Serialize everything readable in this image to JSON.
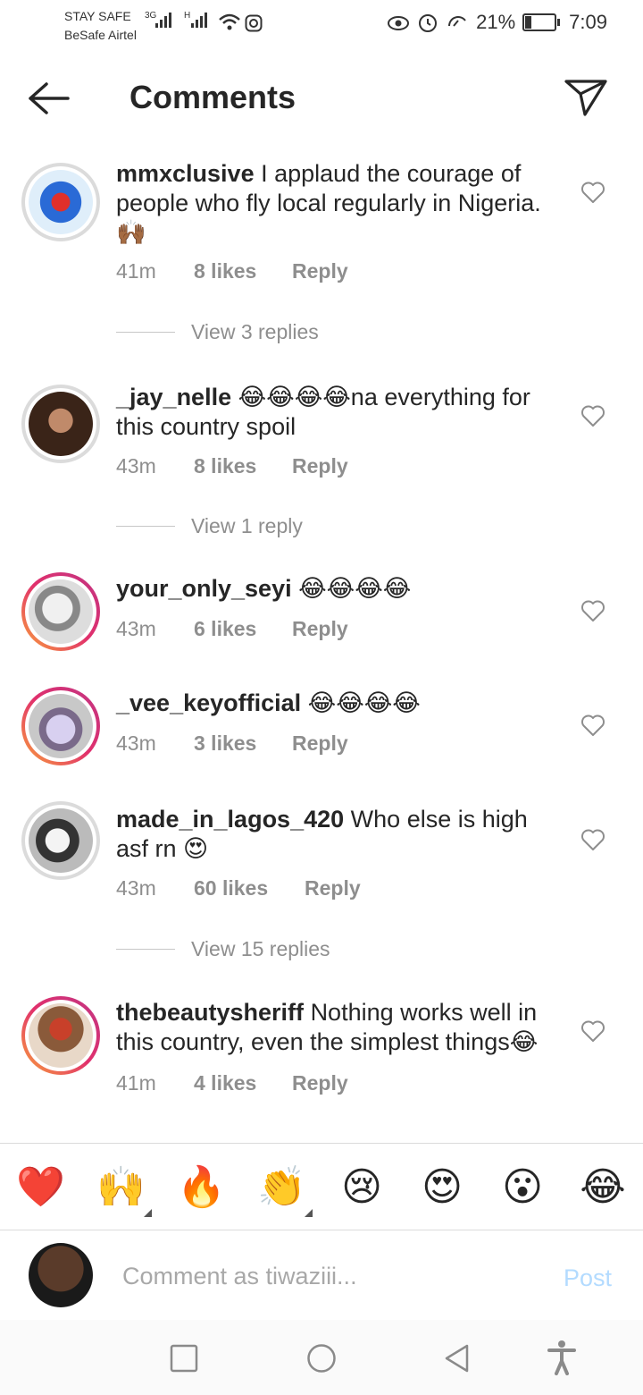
{
  "status_bar": {
    "carrier_line1": "STAY SAFE",
    "carrier_line2": "BeSafe Airtel",
    "net1": "3G",
    "net2": "H",
    "battery_percent": "21%",
    "battery_level": 0.21,
    "time": "7:09"
  },
  "header": {
    "title": "Comments"
  },
  "comments": [
    {
      "username": "mmxclusive",
      "text": "I applaud the courage of people who fly local regularly in Nigeria. 🙌🏾",
      "time": "41m",
      "likes": "8 likes",
      "reply": "Reply",
      "view_replies": "View 3 replies"
    },
    {
      "username": "_jay_nelle",
      "text": "😂😂😂😂na everything for this country spoil",
      "time": "43m",
      "likes": "8 likes",
      "reply": "Reply",
      "view_replies": "View 1 reply"
    },
    {
      "username": "your_only_seyi",
      "text": "😂😂😂😂",
      "time": "43m",
      "likes": "6 likes",
      "reply": "Reply"
    },
    {
      "username": "_vee_keyofficial",
      "text": "😂😂😂😂",
      "time": "43m",
      "likes": "3 likes",
      "reply": "Reply"
    },
    {
      "username": "made_in_lagos_420",
      "text": "Who else is high asf rn 😍",
      "time": "43m",
      "likes": "60 likes",
      "reply": "Reply",
      "view_replies": "View 15 replies"
    },
    {
      "username": "thebeautysheriff",
      "text": "Nothing works well in this country, even the simplest things😂",
      "time": "41m",
      "likes": "4 likes",
      "reply": "Reply"
    }
  ],
  "emoji_bar": [
    "❤️",
    "🙌",
    "🔥",
    "👏",
    "😢",
    "😍",
    "😮",
    "😂"
  ],
  "composer": {
    "placeholder": "Comment as tiwaziii...",
    "post_label": "Post"
  }
}
